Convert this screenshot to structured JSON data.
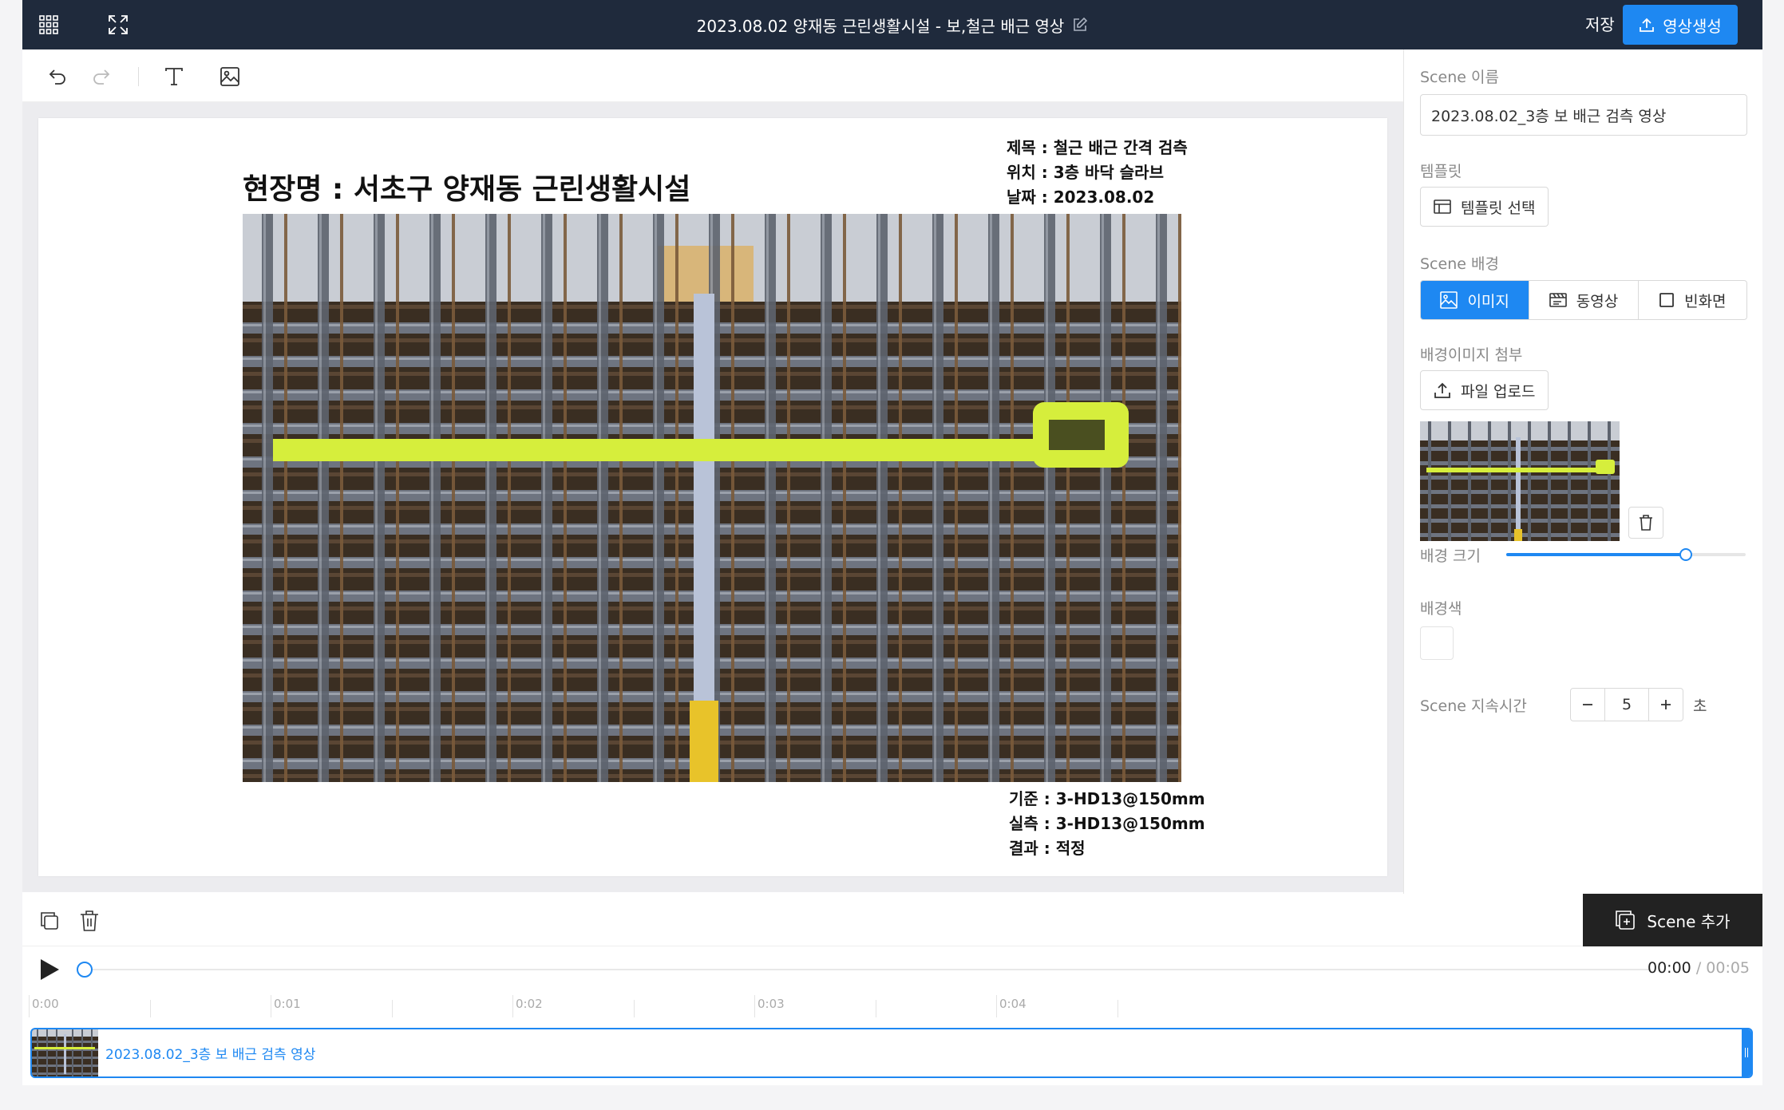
{
  "header": {
    "title": "2023.08.02 양재동 근린생활시설 - 보,철근 배근 영상",
    "save_label": "저장",
    "generate_label": "영상생성"
  },
  "slide": {
    "title": "현장명 : 서초구 양재동 근린생활시설",
    "info_top": [
      "제목 : 철근 배근 간격 검측",
      "위치 : 3층 바닥 슬라브",
      "날짜 : 2023.08.02"
    ],
    "info_bottom": [
      "기준 : 3-HD13@150mm",
      "실측 : 3-HD13@150mm",
      "결과 : 적정"
    ]
  },
  "panel": {
    "scene_name_label": "Scene 이름",
    "scene_name_value": "2023.08.02_3층 보 배근 검측 영상",
    "template_label": "템플릿",
    "template_button": "템플릿 선택",
    "background_label": "Scene 배경",
    "background_options": [
      "이미지",
      "동영상",
      "빈화면"
    ],
    "background_selected": "이미지",
    "bg_image_label": "배경이미지 첨부",
    "upload_button": "파일 업로드",
    "bg_size_label": "배경 크기",
    "bg_size_fraction": 0.75,
    "bg_color_label": "배경색",
    "bg_color_value": "#ffffff",
    "duration_label": "Scene 지속시간",
    "duration_value": "5",
    "duration_unit": "초"
  },
  "timeline": {
    "add_scene_label": "Scene 추가",
    "current_time": "00:00",
    "separator": "/",
    "total_time": "00:05",
    "ruler_labels": [
      "0:00",
      "0:01",
      "0:02",
      "0:03",
      "0:04"
    ],
    "clip_label": "2023.08.02_3층 보 배근 검측 영상",
    "progress_fraction": 0
  },
  "colors": {
    "accent": "#1e88f2",
    "topbar": "#1f2a3c",
    "tape": "#d6ee3c",
    "dark_button": "#222222"
  },
  "icons": {
    "apps": "apps-grid-icon",
    "fullscreen": "fullscreen-icon",
    "edit": "edit-pencil-icon",
    "upload": "upload-icon",
    "undo": "undo-icon",
    "redo": "redo-icon",
    "text": "text-tool-icon",
    "image": "image-tool-icon",
    "copy": "copy-icon",
    "delete": "trash-icon",
    "play": "play-icon"
  }
}
